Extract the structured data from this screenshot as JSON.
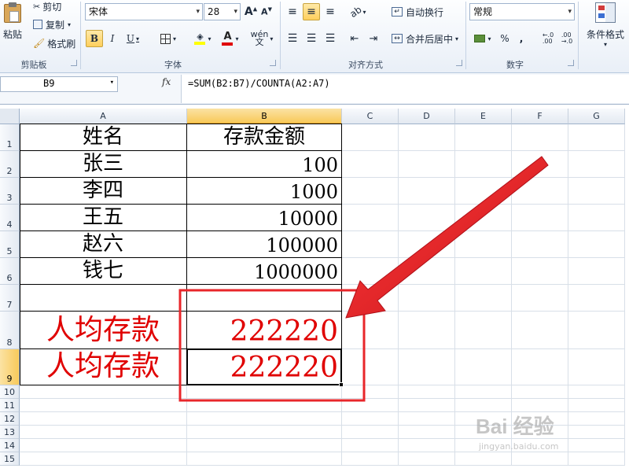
{
  "ribbon": {
    "clipboard": {
      "paste": "粘贴",
      "cut": "剪切",
      "copy": "复制",
      "format_painter": "格式刷",
      "group_label": "剪贴板"
    },
    "font": {
      "font_name": "宋体",
      "font_size": "28",
      "group_label": "字体",
      "bold": "B",
      "italic": "I",
      "underline": "U"
    },
    "alignment": {
      "wrap_text": "自动换行",
      "merge_center": "合并后居中",
      "group_label": "对齐方式"
    },
    "number": {
      "format": "常规",
      "percent": "%",
      "comma": ",",
      "group_label": "数字"
    },
    "styles": {
      "conditional_format": "条件格式"
    }
  },
  "formula_bar": {
    "name_box": "B9",
    "fx": "fx",
    "formula": "=SUM(B2:B7)/COUNTA(A2:A7)"
  },
  "columns": [
    "A",
    "B",
    "C",
    "D",
    "E",
    "F",
    "G"
  ],
  "rows": [
    "1",
    "2",
    "3",
    "4",
    "5",
    "6",
    "7",
    "8",
    "9",
    "10",
    "11",
    "12",
    "13",
    "14",
    "15"
  ],
  "cells": {
    "A1": "姓名",
    "B1": "存款金额",
    "A2": "张三",
    "B2": "100",
    "A3": "李四",
    "B3": "1000",
    "A4": "王五",
    "B4": "10000",
    "A5": "赵六",
    "B5": "100000",
    "A6": "钱七",
    "B6": "1000000",
    "A7": "",
    "B7": "",
    "A8": "人均存款",
    "B8": "222220",
    "A9": "人均存款",
    "B9": "222220"
  },
  "selection": {
    "active_cell": "B9",
    "selected_column": "B",
    "selected_row": "9"
  },
  "annotation": {
    "arrow_color": "#e8262a",
    "box_color": "#e8262a"
  },
  "watermark": {
    "brand": "Bai 经验",
    "url": "jingyan.baidu.com"
  },
  "colors": {
    "red_text": "#e00000",
    "header_selected": "#f8c95a"
  }
}
